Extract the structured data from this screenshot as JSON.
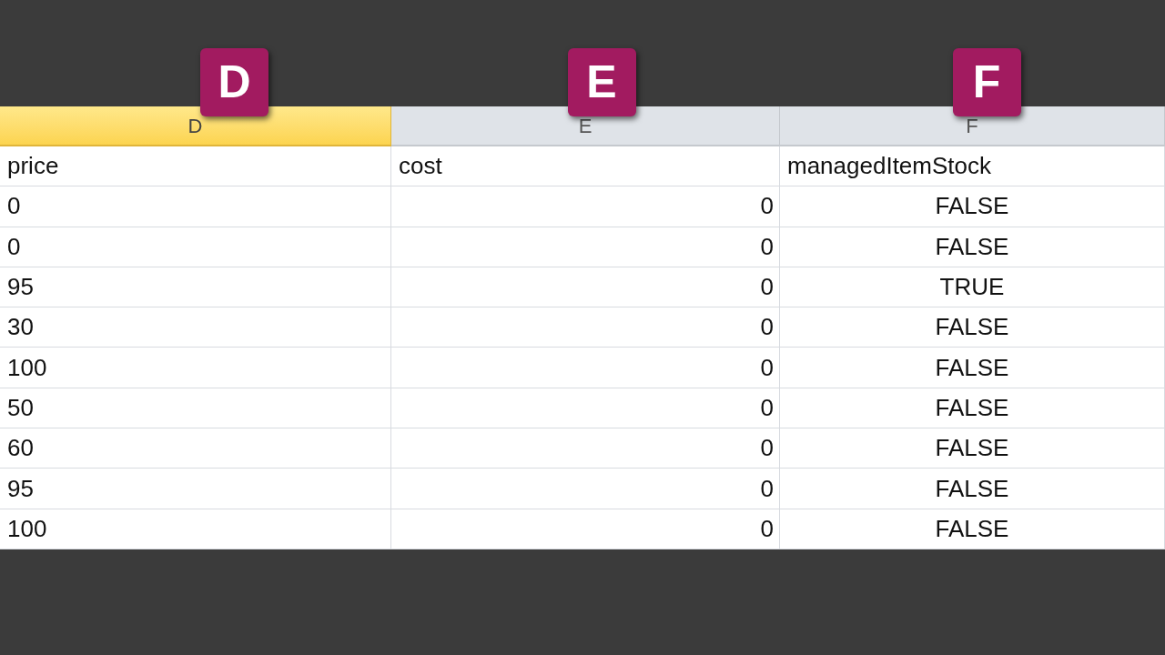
{
  "badges": [
    {
      "label": "D"
    },
    {
      "label": "E"
    },
    {
      "label": "F"
    }
  ],
  "table": {
    "columns": [
      {
        "letter": "D",
        "selected": true,
        "kind": "text"
      },
      {
        "letter": "E",
        "selected": false,
        "kind": "number"
      },
      {
        "letter": "F",
        "selected": false,
        "kind": "boolean"
      }
    ],
    "header_row": [
      "price",
      "cost",
      "managedItemStock"
    ],
    "rows": [
      [
        "0",
        "0",
        "FALSE"
      ],
      [
        "0",
        "0",
        "FALSE"
      ],
      [
        "95",
        "0",
        "TRUE"
      ],
      [
        "30",
        "0",
        "FALSE"
      ],
      [
        "100",
        "0",
        "FALSE"
      ],
      [
        "50",
        "0",
        "FALSE"
      ],
      [
        "60",
        "0",
        "FALSE"
      ],
      [
        "95",
        "0",
        "FALSE"
      ],
      [
        "100",
        "0",
        "FALSE"
      ]
    ]
  }
}
